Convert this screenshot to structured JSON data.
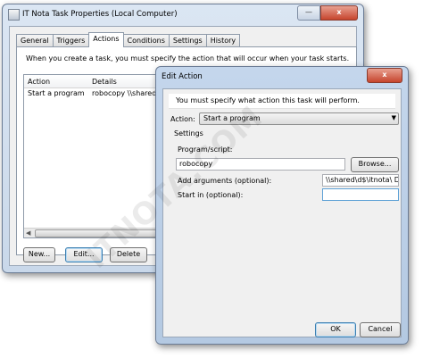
{
  "task_window": {
    "title": "IT Nota Task Properties (Local Computer)",
    "close_label": "x",
    "tabs": [
      "General",
      "Triggers",
      "Actions",
      "Conditions",
      "Settings",
      "History"
    ],
    "active_tab": "Actions",
    "intro_text": "When you create a task, you must specify the action that will occur when your task starts.",
    "columns": [
      "Action",
      "Details"
    ],
    "rows": [
      {
        "action": "Start a program",
        "details": "robocopy \\\\shared\\d$"
      }
    ],
    "buttons": {
      "new": "New...",
      "edit": "Edit...",
      "delete": "Delete"
    }
  },
  "edit_action": {
    "title": "Edit Action",
    "close_label": "x",
    "warning": "You must specify what action this task will perform.",
    "action_label": "Action:",
    "action_value": "Start a program",
    "settings_label": "Settings",
    "program_label": "Program/script:",
    "program_value": "robocopy",
    "browse_label": "Browse...",
    "args_label": "Add arguments (optional):",
    "args_value": "\\\\shared\\d$\\itnota\\ D:\\it",
    "startin_label": "Start in (optional):",
    "startin_value": "",
    "ok_label": "OK",
    "cancel_label": "Cancel"
  },
  "watermark": "ITNOTA.COM"
}
